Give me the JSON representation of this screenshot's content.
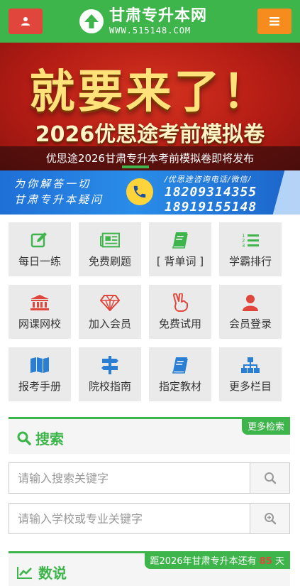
{
  "header": {
    "logo_title": "甘肃专升本网",
    "logo_url": "WWW.515148.COM",
    "user_icon": "user-icon",
    "menu_icon": "hamburger-icon",
    "colors": {
      "bar": "#3db54a",
      "user_btn": "#e0463b",
      "menu_btn": "#f78c1e"
    }
  },
  "banner": {
    "main_text": "就要来了！",
    "sub_text": "2026优思途考前模拟卷",
    "caption": "优思途2026甘肃专升本考前模拟卷即将发布"
  },
  "consult": {
    "left_line1": "为你解答一切",
    "left_line2": "甘肃专升本疑问",
    "label": "/优思途咨询电话/微信/",
    "phone1": "18209314355",
    "phone2": "18919155148"
  },
  "menu": [
    {
      "label": "每日一练",
      "icon": "edit-icon",
      "color": "#3db54a"
    },
    {
      "label": "免费刷题",
      "icon": "newspaper-icon",
      "color": "#3db54a"
    },
    {
      "label": "[ 背单词 ]",
      "icon": "book-icon",
      "color": "#3db54a"
    },
    {
      "label": "学霸排行",
      "icon": "ordered-list-icon",
      "color": "#3db54a"
    },
    {
      "label": "网课网校",
      "icon": "institution-icon",
      "color": "#e0463b"
    },
    {
      "label": "加入会员",
      "icon": "diamond-icon",
      "color": "#e0463b"
    },
    {
      "label": "免费试用",
      "icon": "hand-peace-icon",
      "color": "#e0463b"
    },
    {
      "label": "会员登录",
      "icon": "user-icon",
      "color": "#e0463b"
    },
    {
      "label": "报考手册",
      "icon": "map-icon",
      "color": "#2a7fd4"
    },
    {
      "label": "院校指南",
      "icon": "signpost-icon",
      "color": "#2a7fd4"
    },
    {
      "label": "指定教材",
      "icon": "book-icon",
      "color": "#2a7fd4"
    },
    {
      "label": "更多栏目",
      "icon": "sitemap-icon",
      "color": "#2a7fd4"
    }
  ],
  "search": {
    "title": "搜索",
    "more": "更多检索",
    "placeholder1": "请输入搜索关键字",
    "placeholder2": "请输入学校或专业关键字"
  },
  "stats": {
    "title": "数说",
    "countdown_prefix": "距2026年甘肃专升本还有",
    "countdown_days": "85",
    "countdown_suffix": "天"
  }
}
